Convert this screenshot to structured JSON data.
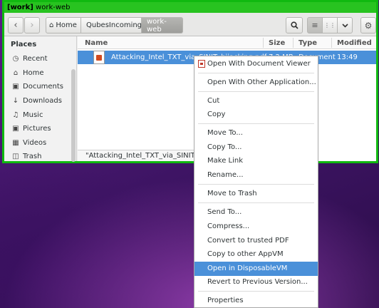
{
  "window": {
    "vm_tag": "[work]",
    "title": "work-web",
    "accent": "#28c320"
  },
  "toolbar": {
    "back_icon": "chevron-left",
    "forward_icon": "chevron-right",
    "path": [
      "Home",
      "QubesIncoming",
      "work-web"
    ],
    "icons": [
      "search-icon",
      "list-view-icon",
      "grid-view-icon",
      "chevron-down-icon",
      "gear-icon"
    ]
  },
  "sidebar": {
    "heading": "Places",
    "items": [
      {
        "label": "Recent",
        "icon": "clock-icon"
      },
      {
        "label": "Home",
        "icon": "home-icon"
      },
      {
        "label": "Documents",
        "icon": "document-icon"
      },
      {
        "label": "Downloads",
        "icon": "download-icon"
      },
      {
        "label": "Music",
        "icon": "music-icon"
      },
      {
        "label": "Pictures",
        "icon": "camera-icon"
      },
      {
        "label": "Videos",
        "icon": "film-icon"
      },
      {
        "label": "Trash",
        "icon": "trash-icon"
      }
    ]
  },
  "files": {
    "columns": [
      "Name",
      "Size",
      "Type",
      "Modified"
    ],
    "rows": [
      {
        "name": "Attacking_Intel_TXT_via_SINIT_hijacking.pdf",
        "size": "7.2 MB",
        "type": "Document",
        "modified": "13:49"
      }
    ],
    "status": "\"Attacking_Intel_TXT_via_SINIT_hi"
  },
  "context_menu": {
    "open_with_viewer": "Open With Document Viewer",
    "open_with_other": "Open With Other Application...",
    "cut": "Cut",
    "copy": "Copy",
    "move_to": "Move To...",
    "copy_to": "Copy To...",
    "make_link": "Make Link",
    "rename": "Rename...",
    "move_to_trash": "Move to Trash",
    "send_to": "Send To...",
    "compress": "Compress...",
    "convert_pdf": "Convert to trusted PDF",
    "copy_appvm": "Copy to other AppVM",
    "open_dispvm": "Open in DisposableVM",
    "revert": "Revert to Previous Version...",
    "properties": "Properties",
    "highlight_color": "#4a90d9"
  }
}
